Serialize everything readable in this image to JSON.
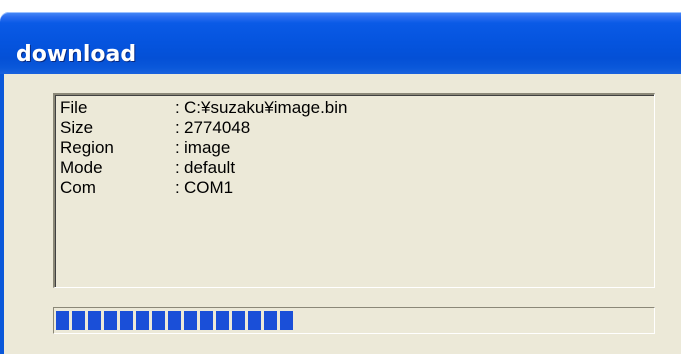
{
  "window": {
    "title": "download"
  },
  "info": {
    "rows": [
      {
        "label": "File",
        "separator": ":",
        "value": "C:¥suzaku¥image.bin"
      },
      {
        "label": "Size",
        "separator": ":",
        "value": "2774048"
      },
      {
        "label": "Region",
        "separator": ":",
        "value": "image"
      },
      {
        "label": "Mode",
        "separator": ":",
        "value": "default"
      },
      {
        "label": "Com",
        "separator": ":",
        "value": "COM1"
      }
    ]
  },
  "progress": {
    "fraction": 0.42,
    "blocks": 15,
    "color": "#1a4fd8"
  },
  "colors": {
    "titlebar": "#0554de",
    "client_bg": "#ece9d8"
  }
}
